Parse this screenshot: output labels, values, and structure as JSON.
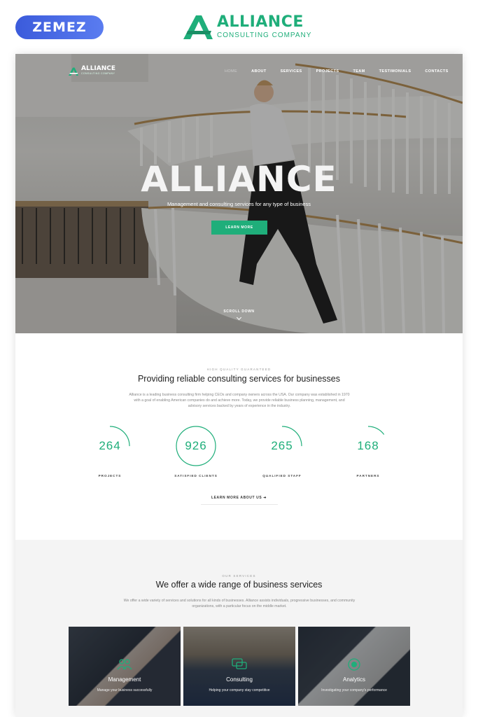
{
  "promo": {
    "vendor": "ZEMEZ",
    "brand_name": "ALLIANCE",
    "brand_sub": "CONSULTING COMPANY"
  },
  "nav": {
    "logo_name": "ALLIANCE",
    "logo_sub": "CONSULTING COMPANY",
    "items": [
      "HOME",
      "ABOUT",
      "SERVICES",
      "PROJECTS",
      "TEAM",
      "TESTIMONIALS",
      "CONTACTS"
    ],
    "active": "HOME"
  },
  "hero": {
    "title": "ALLIANCE",
    "subtitle": "Management and consulting services for any type of business",
    "button": "LEARN MORE",
    "scroll": "SCROLL DOWN"
  },
  "about": {
    "eyebrow": "HIGH QUALITY GUARANTEED",
    "title": "Providing reliable consulting services for businesses",
    "description": "Alliance is a leading business consulting firm helping CEOs and company owners across the USA. Our company was established in 1970 with a goal of enabling American companies do and achieve more. Today, we provide reliable business planning, management, and advisory services backed by years of experience in the industry.",
    "stats": [
      {
        "value": "264",
        "label": "PROJECTS",
        "progress": 0.25
      },
      {
        "value": "926",
        "label": "SATISFIED CLIENTS",
        "progress": 1.0
      },
      {
        "value": "265",
        "label": "QUALIFIED STAFF",
        "progress": 0.25
      },
      {
        "value": "168",
        "label": "PARTNERS",
        "progress": 0.15
      }
    ],
    "learn_more": "LEARN MORE ABOUT US"
  },
  "services": {
    "eyebrow": "OUR SERVICES",
    "title": "We offer a wide range of business services",
    "description": "We offer a wide variety of services and solutions for all kinds of businesses. Alliance assists individuals, progressive businesses, and community organizations, with a particular focus on the middle market.",
    "cards": [
      {
        "title": "Management",
        "desc": "Manage your business successfully",
        "icon": "team-icon"
      },
      {
        "title": "Consulting",
        "desc": "Helping your company stay competitive",
        "icon": "chat-icon"
      },
      {
        "title": "Analytics",
        "desc": "Investigating your company's performance",
        "icon": "target-icon"
      }
    ]
  },
  "colors": {
    "accent": "#1fae7a",
    "badge": "#3b5bdb",
    "services_bg": "#f4f4f4"
  }
}
